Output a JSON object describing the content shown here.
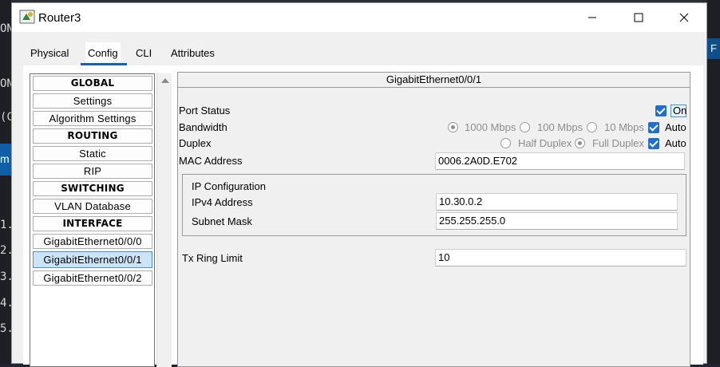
{
  "background": {
    "left_lines": [
      "ON",
      "ON",
      "(C",
      "m",
      "1.",
      "2.",
      "3.",
      "4.",
      "5."
    ],
    "right_tab": "F"
  },
  "window": {
    "title": "Router3",
    "minimize_icon": "minimize-icon",
    "maximize_icon": "maximize-icon",
    "close_icon": "close-icon"
  },
  "tabs": [
    {
      "label": "Physical",
      "active": false
    },
    {
      "label": "Config",
      "active": true
    },
    {
      "label": "CLI",
      "active": false
    },
    {
      "label": "Attributes",
      "active": false
    }
  ],
  "sidebar": {
    "items": [
      {
        "label": "GLOBAL",
        "header": true
      },
      {
        "label": "Settings"
      },
      {
        "label": "Algorithm Settings"
      },
      {
        "label": "ROUTING",
        "header": true
      },
      {
        "label": "Static"
      },
      {
        "label": "RIP"
      },
      {
        "label": "SWITCHING",
        "header": true
      },
      {
        "label": "VLAN Database"
      },
      {
        "label": "INTERFACE",
        "header": true
      },
      {
        "label": "GigabitEthernet0/0/0"
      },
      {
        "label": "GigabitEthernet0/0/1",
        "selected": true
      },
      {
        "label": "GigabitEthernet0/0/2"
      }
    ]
  },
  "interface": {
    "title": "GigabitEthernet0/0/1",
    "port_status_label": "Port Status",
    "port_status_on": "On",
    "bandwidth_label": "Bandwidth",
    "bandwidth_options": [
      "1000 Mbps",
      "100 Mbps",
      "10 Mbps"
    ],
    "bandwidth_auto": "Auto",
    "duplex_label": "Duplex",
    "duplex_options": [
      "Half Duplex",
      "Full Duplex"
    ],
    "duplex_auto": "Auto",
    "mac_label": "MAC Address",
    "mac_value": "0006.2A0D.E702",
    "ip_config_label": "IP Configuration",
    "ipv4_label": "IPv4 Address",
    "ipv4_value": "10.30.0.2",
    "subnet_label": "Subnet Mask",
    "subnet_value": "255.255.255.0",
    "tx_ring_label": "Tx Ring Limit",
    "tx_ring_value": "10"
  },
  "colors": {
    "accent": "#1f6fce",
    "selected_bg": "#cce4f7",
    "disabled_text": "#8d8d8d"
  }
}
